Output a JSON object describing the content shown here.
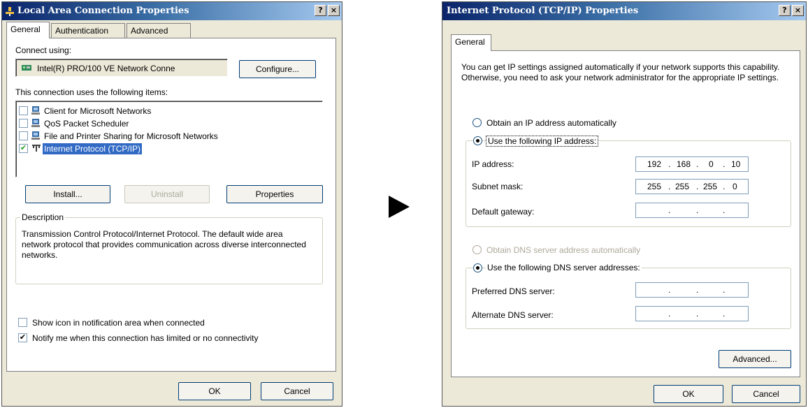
{
  "lac": {
    "title": "Local Area Connection Properties",
    "help": "?",
    "close": "×",
    "tabs": [
      "General",
      "Authentication",
      "Advanced"
    ],
    "connect_using": "Connect using:",
    "adapter": "Intel(R) PRO/100 VE Network Conne",
    "configure": "Configure...",
    "items_label": "This connection uses the following items:",
    "items": [
      {
        "label": "Client for Microsoft Networks",
        "checked": false
      },
      {
        "label": "QoS Packet Scheduler",
        "checked": false
      },
      {
        "label": "File and Printer Sharing for Microsoft Networks",
        "checked": false
      },
      {
        "label": "Internet Protocol (TCP/IP)",
        "checked": true,
        "selected": true
      }
    ],
    "install": "Install...",
    "uninstall": "Uninstall",
    "properties": "Properties",
    "description_title": "Description",
    "description": "Transmission Control Protocol/Internet Protocol. The default wide area network protocol that provides communication across diverse interconnected networks.",
    "show_icon": "Show icon in notification area when connected",
    "notify": "Notify me when this connection has limited or no connectivity",
    "ok": "OK",
    "cancel": "Cancel"
  },
  "tcp": {
    "title": "Internet Protocol (TCP/IP) Properties",
    "help": "?",
    "close": "×",
    "tab": "General",
    "intro": "You can get IP settings assigned automatically if your network supports this capability. Otherwise, you need to ask your network administrator for the appropriate IP settings.",
    "obtain_ip": "Obtain an IP address automatically",
    "use_ip": "Use the following IP address:",
    "ip_label": "IP address:",
    "ip": [
      "192",
      "168",
      "0",
      "10"
    ],
    "subnet_label": "Subnet mask:",
    "subnet": [
      "255",
      "255",
      "255",
      "0"
    ],
    "gateway_label": "Default gateway:",
    "obtain_dns": "Obtain DNS server address automatically",
    "use_dns": "Use the following DNS server addresses:",
    "preferred_label": "Preferred DNS server:",
    "alternate_label": "Alternate DNS server:",
    "advanced": "Advanced...",
    "ok": "OK",
    "cancel": "Cancel"
  },
  "colors": {
    "selection": "#316ac5",
    "title_start": "#0a246a",
    "face": "#ece9d8"
  }
}
